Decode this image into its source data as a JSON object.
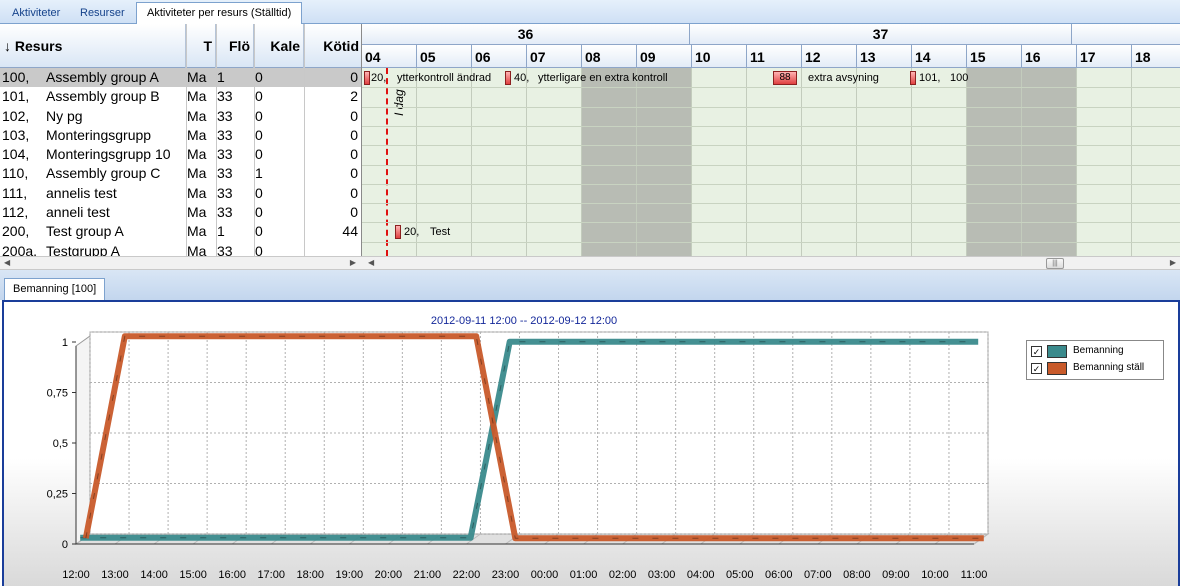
{
  "tabs": [
    {
      "label": "Aktiviteter",
      "active": false
    },
    {
      "label": "Resurser",
      "active": false
    },
    {
      "label": "Aktiviteter per resurs (Ställtid)",
      "active": true
    }
  ],
  "resource_table": {
    "columns": [
      "↓ Resurs",
      "T",
      "Flö",
      "Kale",
      "Kötid"
    ],
    "rows": [
      {
        "id": "100,",
        "name": "Assembly group A",
        "t": "Ma",
        "flo": "1",
        "kale": "0",
        "kotid": "0",
        "selected": true
      },
      {
        "id": "101,",
        "name": "Assembly group B",
        "t": "Ma",
        "flo": "33",
        "kale": "0",
        "kotid": "2"
      },
      {
        "id": "102,",
        "name": "Ny pg",
        "t": "Ma",
        "flo": "33",
        "kale": "0",
        "kotid": "0"
      },
      {
        "id": "103,",
        "name": "Monteringsgrupp",
        "t": "Ma",
        "flo": "33",
        "kale": "0",
        "kotid": "0"
      },
      {
        "id": "104,",
        "name": " Monteringsgrupp 10",
        "t": "Ma",
        "flo": "33",
        "kale": "0",
        "kotid": "0"
      },
      {
        "id": "110,",
        "name": "Assembly group C",
        "t": "Ma",
        "flo": "33",
        "kale": "1",
        "kotid": "0"
      },
      {
        "id": "111,",
        "name": "annelis test",
        "t": "Ma",
        "flo": "33",
        "kale": "0",
        "kotid": "0"
      },
      {
        "id": "112,",
        "name": "anneli test",
        "t": "Ma",
        "flo": "33",
        "kale": "0",
        "kotid": "0"
      },
      {
        "id": "200,",
        "name": "Test group A",
        "t": "Ma",
        "flo": "1",
        "kale": "0",
        "kotid": "44"
      },
      {
        "id": "200a,",
        "name": "Testgrupp A",
        "t": "Ma",
        "flo": "33",
        "kale": "0",
        "kotid": ""
      }
    ]
  },
  "gantt": {
    "weeks": [
      {
        "label": "36"
      },
      {
        "label": "37"
      }
    ],
    "days": [
      "04",
      "05",
      "06",
      "07",
      "08",
      "09",
      "10",
      "11",
      "12",
      "13",
      "14",
      "15",
      "16",
      "17",
      "18"
    ],
    "weekend_days": [
      "08",
      "09",
      "15",
      "16"
    ],
    "today_label": "I dag",
    "activities": [
      {
        "row": 0,
        "text": "20,",
        "day": 0
      },
      {
        "text": "ytterkontroll ändrad"
      },
      {
        "text": "40,"
      },
      {
        "text": "ytterligare en extra kontroll"
      },
      {
        "text": "88"
      },
      {
        "text": "extra avsyning"
      },
      {
        "text": "101,"
      },
      {
        "text": "100"
      },
      {
        "text": "20,"
      },
      {
        "text": "Test"
      }
    ]
  },
  "bottom_tab": {
    "label": "Bemanning [100]"
  },
  "chart_data": {
    "type": "line",
    "title": "2012-09-11 12:00 -- 2012-09-12 12:00",
    "x": [
      "12:00",
      "13:00",
      "14:00",
      "15:00",
      "16:00",
      "17:00",
      "18:00",
      "19:00",
      "20:00",
      "21:00",
      "22:00",
      "23:00",
      "00:00",
      "01:00",
      "02:00",
      "03:00",
      "04:00",
      "05:00",
      "06:00",
      "07:00",
      "08:00",
      "09:00",
      "10:00",
      "11:00"
    ],
    "y_ticks": [
      "0",
      "0,25",
      "0,5",
      "0,75",
      "1"
    ],
    "ylim": [
      0,
      1
    ],
    "series": [
      {
        "name": "Bemanning",
        "color": "#3a8a8c",
        "points": [
          [
            0,
            0.03
          ],
          [
            10,
            0.03
          ],
          [
            11,
            1
          ],
          [
            23,
            1
          ]
        ]
      },
      {
        "name": "Bemanning ställ",
        "color": "#c85a2a",
        "points": [
          [
            0,
            0
          ],
          [
            1,
            1
          ],
          [
            10,
            1
          ],
          [
            11,
            0
          ],
          [
            23,
            0
          ]
        ]
      }
    ],
    "legend": "top-right",
    "grid": true
  }
}
